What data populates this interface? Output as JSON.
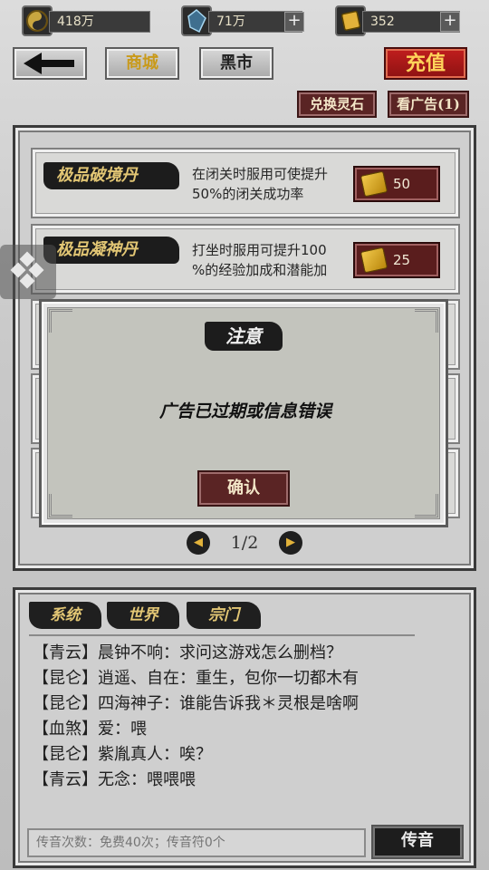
{
  "resources": {
    "coin": {
      "value": "418万"
    },
    "crystal": {
      "value": "71万",
      "plus": "+"
    },
    "gold": {
      "value": "352",
      "plus": "+"
    }
  },
  "nav": {
    "back_label": "⟵",
    "shop_label": "商城",
    "blackmarket_label": "黑市",
    "recharge_label": "充值"
  },
  "actions": {
    "exchange_label": "兑换灵石",
    "watch_ad_label": "看广告(1)"
  },
  "shop_items": [
    {
      "name": "极品破境丹",
      "desc_line1": "在闭关时服用可使提升",
      "desc_line2": "50%的闭关成功率",
      "price": "50"
    },
    {
      "name": "极品凝神丹",
      "desc_line1": "打坐时服用可提升100",
      "desc_line2": "%的经验加成和潜能加",
      "price": "25"
    }
  ],
  "pagination": {
    "prev": "◀",
    "page": "1/2",
    "next": "▶"
  },
  "dialog": {
    "title": "注意",
    "message": "广告已过期或信息错误",
    "confirm_label": "确认"
  },
  "chat": {
    "tabs": [
      "系统",
      "世界",
      "宗门"
    ],
    "messages": [
      "【青云】晨钟不响：求问这游戏怎么删档？",
      "【昆仑】逍遥、自在：重生，包你一切都木有",
      "【昆仑】四海神子：谁能告诉我＊灵根是啥啊",
      "【血煞】爱：喂",
      "【昆仑】紫胤真人：唉？",
      "【青云】无念：喂喂喂"
    ],
    "input_placeholder": "传音次数：免费40次；传音符0个",
    "send_label": "传音"
  },
  "colors": {
    "accent_gold": "#e2c674",
    "recharge_red": "#b81a1a",
    "price_bg": "#5a1d1d"
  }
}
